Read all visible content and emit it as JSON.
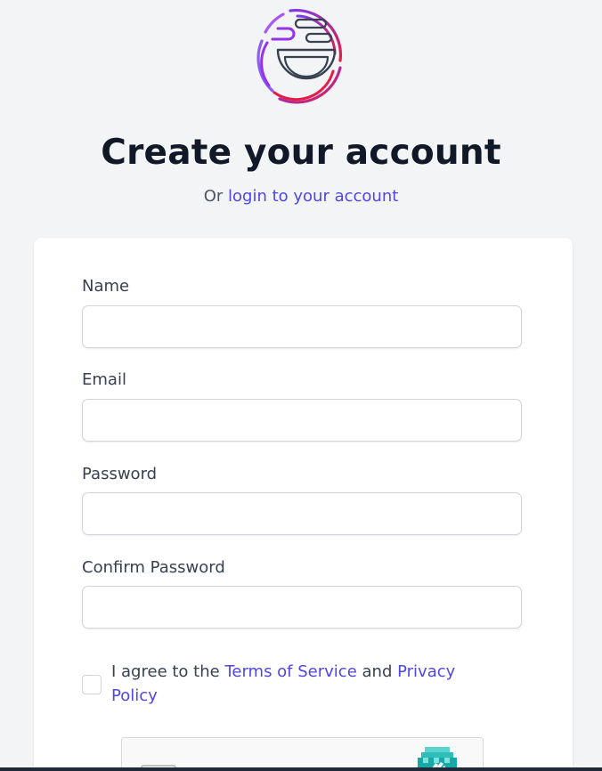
{
  "header": {
    "title": "Create your account",
    "subtitle_prefix": "Or",
    "login_link": "login to your account"
  },
  "form": {
    "fields": [
      {
        "label": "Name",
        "value": "",
        "placeholder": ""
      },
      {
        "label": "Email",
        "value": "",
        "placeholder": ""
      },
      {
        "label": "Password",
        "value": "",
        "placeholder": ""
      },
      {
        "label": "Confirm Password",
        "value": "",
        "placeholder": ""
      }
    ],
    "agree": {
      "prefix": "I agree to the",
      "terms_link": "Terms of Service",
      "and": "and",
      "privacy_link": "Privacy Policy",
      "checked": false
    }
  },
  "icons": {
    "logo": "smiling-bowl-logo-icon",
    "captcha": "captcha-hand-icon"
  },
  "colors": {
    "accent": "#4f46e5",
    "background": "#f3f4f6",
    "logo_gradient_start": "#7c3aed",
    "logo_gradient_end": "#e11d48"
  }
}
